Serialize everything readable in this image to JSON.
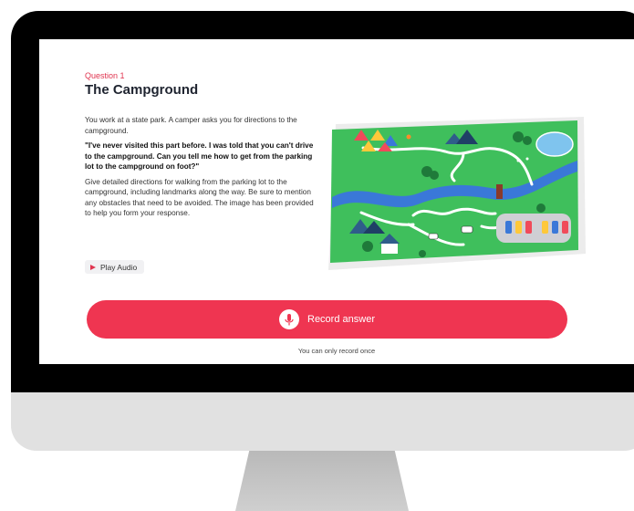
{
  "question": {
    "number_label": "Question 1",
    "title": "The Campground",
    "intro": "You work at a state park. A camper asks you for directions to the campground.",
    "quote": "\"I've never visited this part before. I was told that you can't drive to the campground. Can you tell me how to get from the parking lot to the campground on foot?\"",
    "instructions": "Give detailed directions for walking from the parking lot to the campground, including landmarks along the way. Be sure to mention any obstacles that need to be avoided. The image has been provided to help you form your response."
  },
  "play_audio_label": "Play Audio",
  "record": {
    "label": "Record answer",
    "note": "You can only record once"
  },
  "icons": {
    "play": "play-icon",
    "mic": "microphone-icon"
  },
  "colors": {
    "accent": "#ef3551",
    "map_green": "#3fbf5c",
    "river": "#3a78d8"
  }
}
